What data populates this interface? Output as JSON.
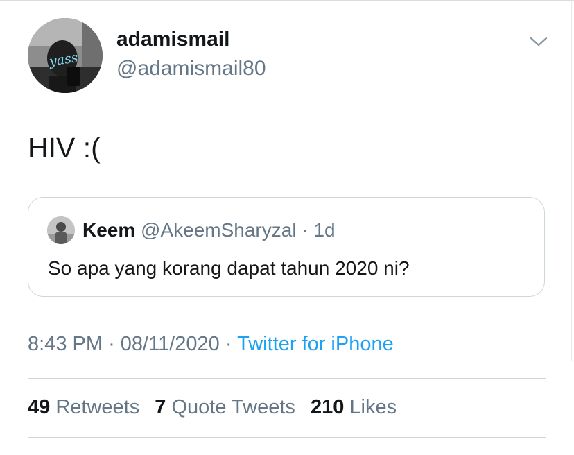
{
  "author": {
    "display_name": "adamismail",
    "handle": "@adamismail80",
    "avatar_logo_text": "yass"
  },
  "tweet": {
    "text": "HIV :("
  },
  "quoted_tweet": {
    "display_name": "Keem",
    "handle": "@AkeemSharyzal",
    "separator": "·",
    "age": "1d",
    "text": "So apa yang korang dapat tahun 2020 ni?"
  },
  "meta": {
    "time": "8:43 PM",
    "separator": "·",
    "date": "08/11/2020",
    "source": "Twitter for iPhone"
  },
  "stats": {
    "retweets": {
      "count": "49",
      "label": "Retweets"
    },
    "quotes": {
      "count": "7",
      "label": "Quote Tweets"
    },
    "likes": {
      "count": "210",
      "label": "Likes"
    }
  },
  "colors": {
    "text_primary": "#14171a",
    "text_secondary": "#657786",
    "link": "#1da1f2",
    "border": "#ccd6dd"
  },
  "icons": {
    "caret": "chevron-down-icon"
  }
}
